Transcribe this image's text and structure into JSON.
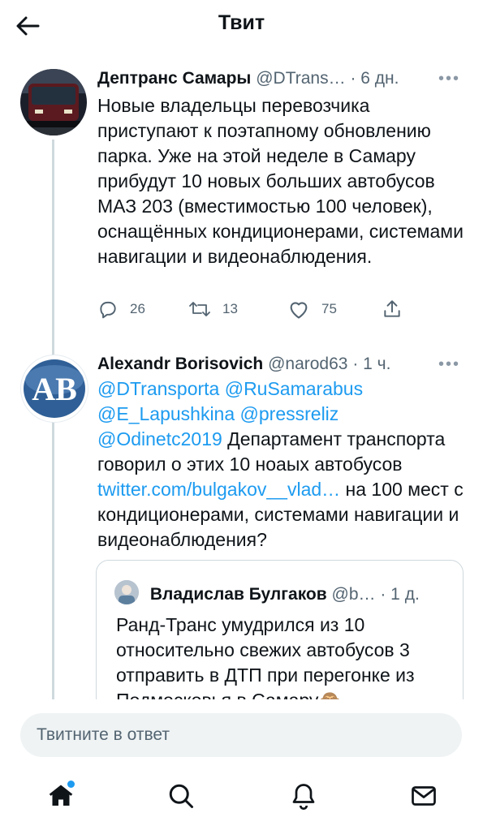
{
  "header": {
    "title": "Твит"
  },
  "tweet1": {
    "name": "Дептранс Самары",
    "handle": "@DTrans…",
    "time": "· 6 дн.",
    "text": "Новые владельцы перевозчика приступают к поэтапному обновлению парка. Уже на этой неделе в Самару прибудут 10 новых больших автобусов МАЗ 203 (вместимостью 100 человек), оснащённых кондиционерами, системами навигации и видеонаблюдения.",
    "replies": "26",
    "retweets": "13",
    "likes": "75"
  },
  "tweet2": {
    "name": "Alexandr Borisovich",
    "handle": "@narod63",
    "time": "· 1 ч.",
    "avatar_text": "AB",
    "mention1": "@DTransporta",
    "mention2": "@RuSamarabus",
    "mention3": "@E_Lapushkina",
    "mention4": "@pressreliz",
    "mention5": "@Odinetc2019",
    "text_a": " Департамент транспорта говорил о этих 10 ноаых автобусов ",
    "link": "twitter.com/bulgakov__vlad…",
    "text_b": " на 100 мест с кондиционерами, системами навигации и видеонаблюдения?"
  },
  "quote": {
    "name": "Владислав Булгаков",
    "handle": "@b…",
    "time": "· 1 д.",
    "text": "Ранд-Транс умудрился из 10 относительно свежих автобусов 3 отправить в ДТП при перегонке из Подмосковья в Самару🙈"
  },
  "reply": {
    "placeholder": "Твитните в ответ"
  },
  "more_label": "•••",
  "colors": {
    "accent": "#1d9bf0",
    "secondary": "#536471",
    "border": "#cfd9de"
  },
  "icons": [
    "back-arrow-icon",
    "reply-icon",
    "retweet-icon",
    "like-icon",
    "share-icon",
    "home-icon",
    "search-icon",
    "notifications-icon",
    "messages-icon"
  ]
}
